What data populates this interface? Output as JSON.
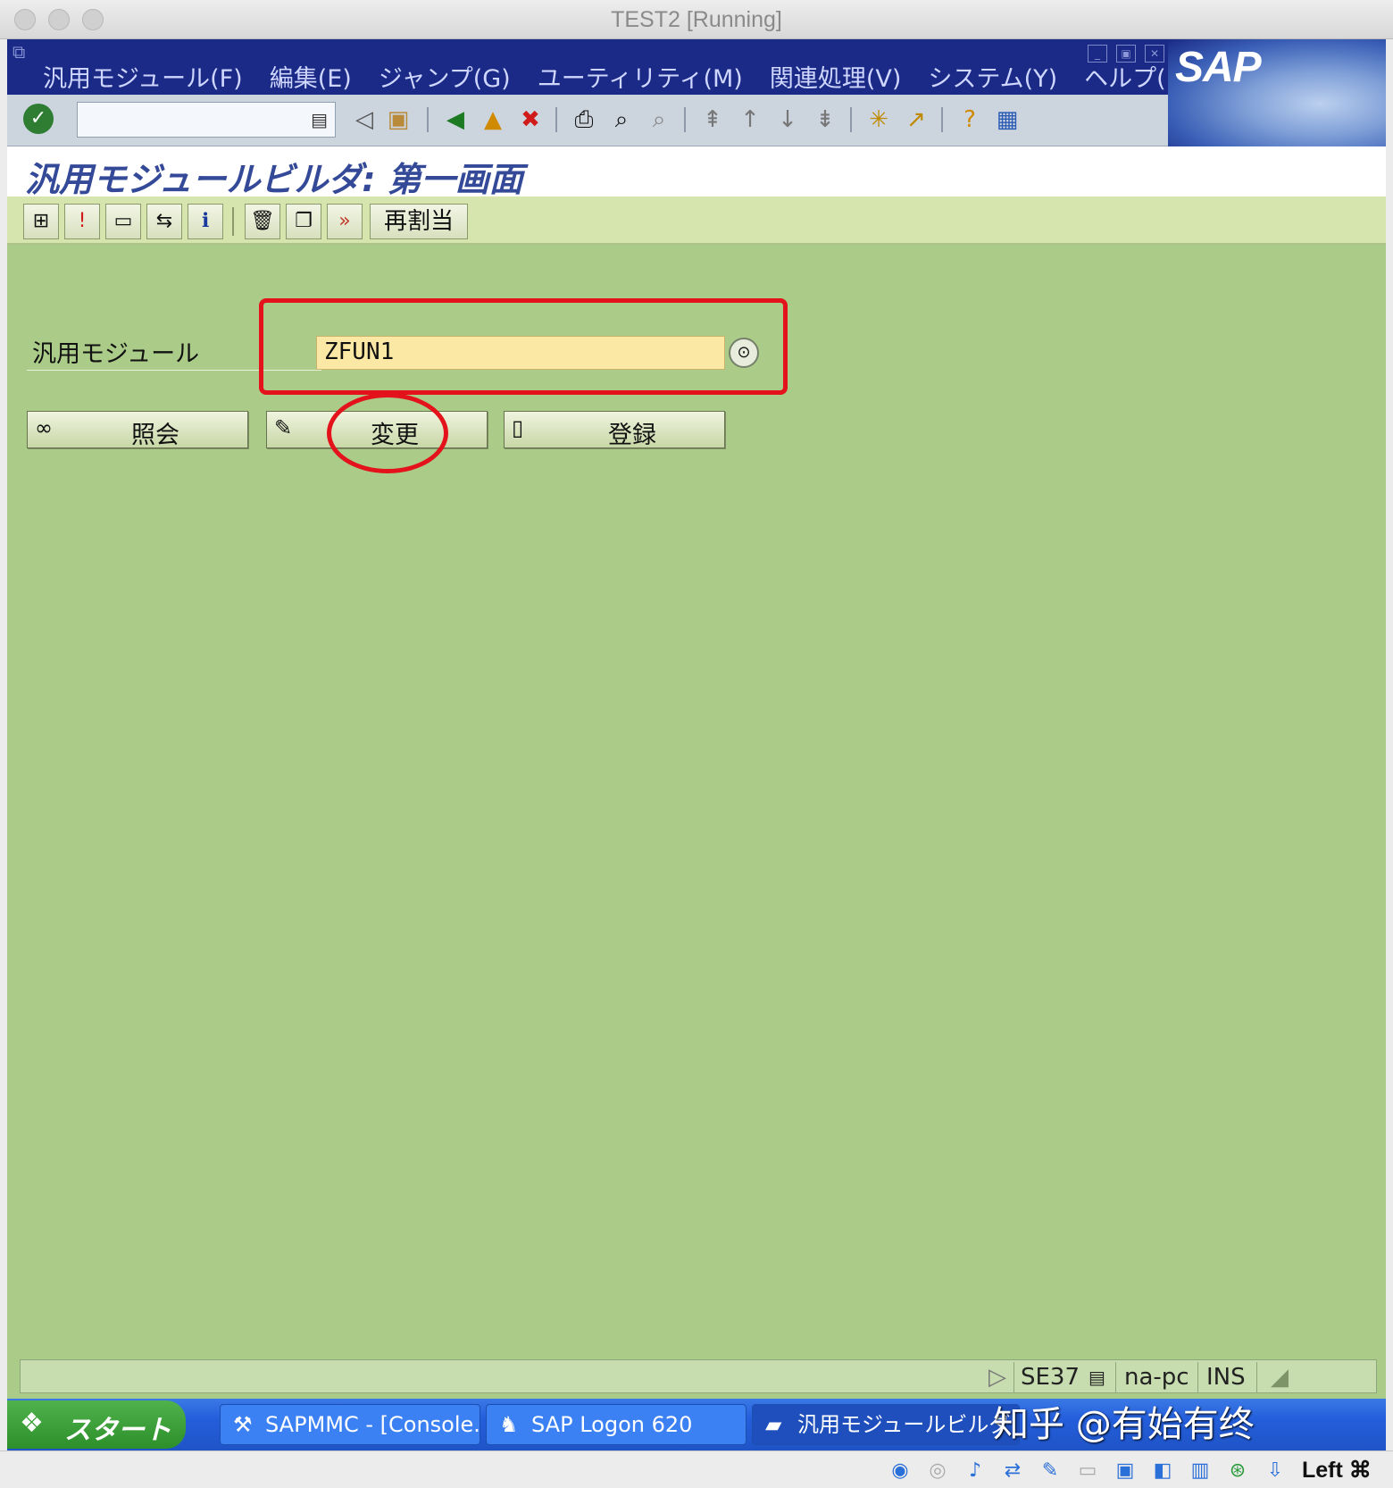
{
  "window": {
    "title": "TEST2 [Running]"
  },
  "menubar": {
    "items": [
      "汎用モジュール(F)",
      "編集(E)",
      "ジャンプ(G)",
      "ユーティリティ(M)",
      "関連処理(V)",
      "システム(Y)",
      "ヘルプ(H)"
    ],
    "logo": "SAP"
  },
  "system_toolbar": {
    "command_field_value": "",
    "icons": [
      "enter-icon",
      "back-arrow-icon",
      "save-icon",
      "back-icon",
      "exit-icon",
      "cancel-icon",
      "print-icon",
      "find-icon",
      "find-next-icon",
      "first-page-icon",
      "previous-page-icon",
      "next-page-icon",
      "last-page-icon",
      "create-session-icon",
      "shortcut-icon",
      "help-icon",
      "customize-layout-icon"
    ]
  },
  "page": {
    "title": "汎用モジュールビルダ: 第一画面"
  },
  "app_toolbar": {
    "reassign_label": "再割当"
  },
  "form": {
    "function_module_label": "汎用モジュール",
    "function_module_value": "ZFUN1",
    "display_button": "照会",
    "change_button": "変更",
    "create_button": "登録"
  },
  "statusbar": {
    "transaction": "SE37",
    "host": "na-pc",
    "mode": "INS"
  },
  "taskbar": {
    "start_label": "スタート",
    "tasks": [
      "SAPMMC - [Console...",
      "SAP Logon 620",
      "汎用モジュールビルダ: ..."
    ],
    "watermark": "知乎 @有始有终"
  },
  "host_status": {
    "host_key": "Left ⌘"
  },
  "colors": {
    "menubar": "#1a2a86",
    "workarea": "#abcb89",
    "input_bg": "#fbe8a4",
    "annotation": "#e3121b"
  }
}
